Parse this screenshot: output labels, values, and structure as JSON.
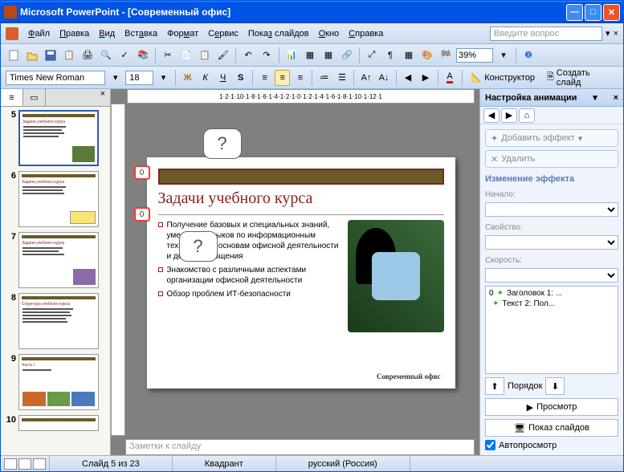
{
  "titlebar": {
    "app": "Microsoft PowerPoint",
    "doc": "[Современный офис]"
  },
  "menu": [
    "Файл",
    "Правка",
    "Вид",
    "Вставка",
    "Формат",
    "Сервис",
    "Показ слайдов",
    "Окно",
    "Справка"
  ],
  "question_placeholder": "Введите вопрос",
  "zoom": "39%",
  "font_name": "Times New Roman",
  "font_size": "18",
  "designer_label": "Конструктор",
  "new_slide_label": "Создать слайд",
  "ruler_text": "1·2·1·10·1·8·1·6·1·4·1·2·1·0·1·2·1·4·1·6·1·8·1·10·1·12·1",
  "thumbs": [
    {
      "n": "5",
      "sel": true
    },
    {
      "n": "6"
    },
    {
      "n": "7"
    },
    {
      "n": "8"
    },
    {
      "n": "9"
    },
    {
      "n": "10"
    }
  ],
  "slide": {
    "title": "Задачи учебного курса",
    "bullets": [
      "Получение базовых и специальных знаний, умений и навыков по информационным технологиям, основам офисной деятельности и делового общения",
      "Знакомство с различными аспектами организации офисной деятельности",
      "Обзор проблем ИТ-безопасности"
    ],
    "footer": "Современный офис",
    "marker": "0",
    "callout": "?"
  },
  "notes_placeholder": "Заметки к слайду",
  "taskpane": {
    "title": "Настройка анимации",
    "add_effect": "Добавить эффект",
    "remove": "Удалить",
    "change_section": "Изменение эффекта",
    "start_label": "Начало:",
    "property_label": "Свойство:",
    "speed_label": "Скорость:",
    "items": [
      {
        "order": "0",
        "name": "Заголовок 1: ..."
      },
      {
        "order": "",
        "name": "Текст 2: Пол..."
      }
    ],
    "order_label": "Порядок",
    "preview": "Просмотр",
    "slideshow": "Показ слайдов",
    "autopreview": "Автопросмотр"
  },
  "status": {
    "slide": "Слайд 5 из 23",
    "template": "Квадрант",
    "lang": "русский (Россия)"
  }
}
